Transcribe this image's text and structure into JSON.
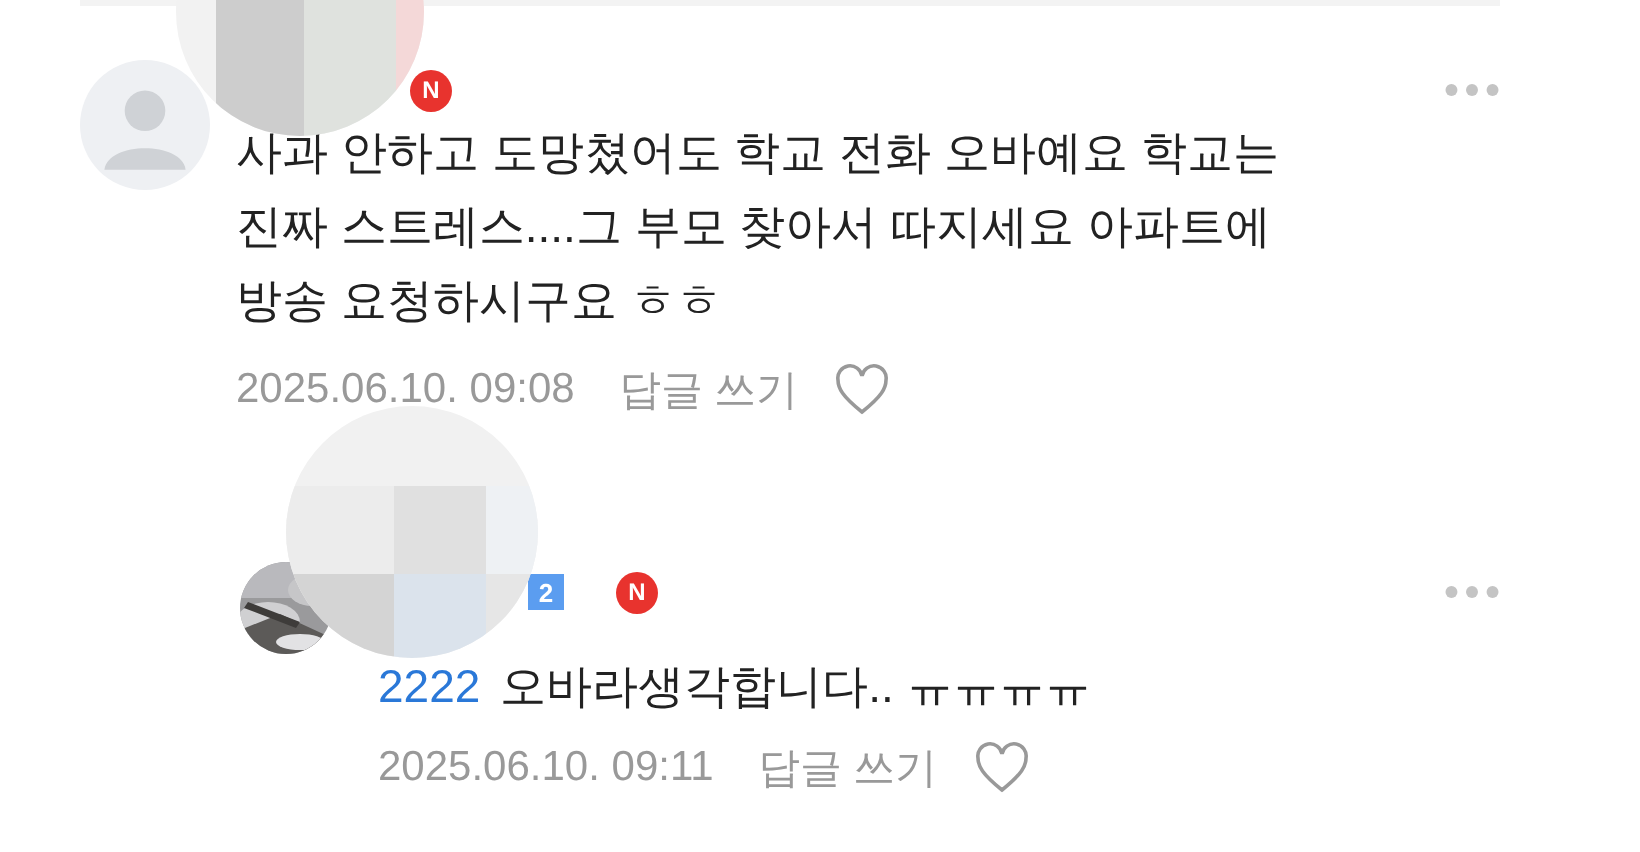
{
  "comments": [
    {
      "new_badge": "N",
      "text": "사과 안하고 도망쳤어도 학교 전화 오바예요 학교는 진짜 스트레스....그 부모 찾아서 따지세요 아파트에 방송 요청하시구요 ㅎㅎ",
      "time": "2025.06.10. 09:08",
      "reply_label": "답글 쓰기",
      "liked": false,
      "replies": [
        {
          "level_badge": "2",
          "new_badge": "N",
          "mention": "2222",
          "text": "오바라생각합니다.. ㅠㅠㅠㅠ",
          "time": "2025.06.10. 09:11",
          "reply_label": "답글 쓰기",
          "liked": false
        }
      ]
    }
  ]
}
